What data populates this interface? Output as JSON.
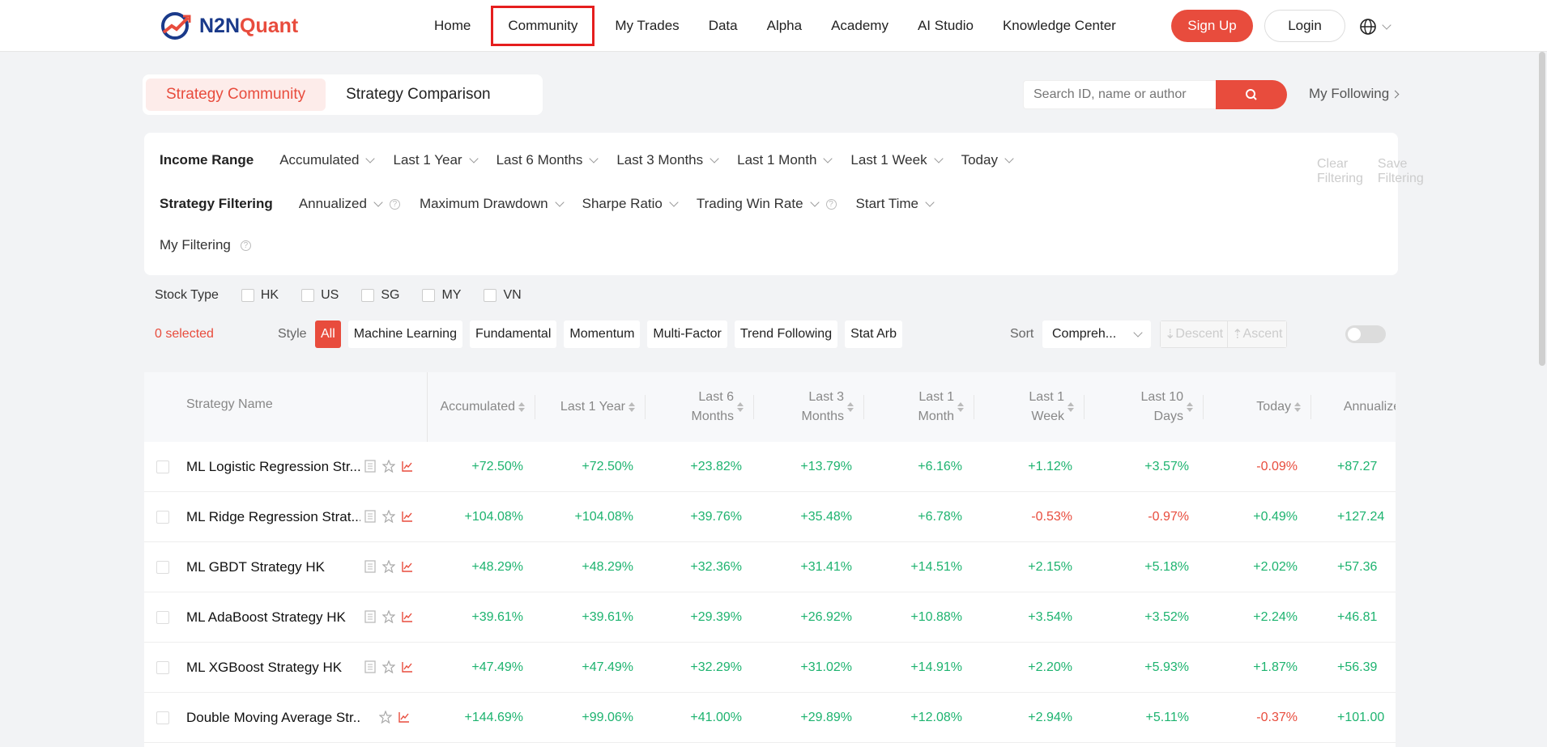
{
  "brand": {
    "part1": "N2N",
    "part2": "Quant"
  },
  "nav": [
    "Home",
    "Community",
    "My Trades",
    "Data",
    "Alpha",
    "Academy",
    "AI Studio",
    "Knowledge Center"
  ],
  "auth": {
    "signup": "Sign Up",
    "login": "Login"
  },
  "tabs": [
    "Strategy Community",
    "Strategy Comparison"
  ],
  "search": {
    "placeholder": "Search ID, name or author"
  },
  "my_following": "My Following",
  "filters": {
    "income_label": "Income Range",
    "income_options": [
      "Accumulated",
      "Last 1 Year",
      "Last 6 Months",
      "Last 3 Months",
      "Last 1 Month",
      "Last 1 Week",
      "Today"
    ],
    "strategy_label": "Strategy Filtering",
    "strategy_options": [
      "Annualized",
      "Maximum Drawdown",
      "Sharpe Ratio",
      "Trading Win Rate",
      "Start Time"
    ],
    "my_label": "My Filtering",
    "clear": "Clear Filtering",
    "save": "Save Filtering"
  },
  "stock": {
    "label": "Stock Type",
    "options": [
      "HK",
      "US",
      "SG",
      "MY",
      "VN"
    ]
  },
  "style": {
    "selected": "0 selected",
    "label": "Style",
    "tags": [
      "All",
      "Machine Learning",
      "Fundamental",
      "Momentum",
      "Multi-Factor",
      "Trend Following",
      "Stat Arb"
    ]
  },
  "sort": {
    "label": "Sort",
    "value": "Compreh...",
    "descent": "Descent",
    "ascent": "Ascent"
  },
  "table": {
    "name_header": "Strategy Name",
    "headers": [
      {
        "l1": "Accumulated",
        "l2": ""
      },
      {
        "l1": "Last 1 Year",
        "l2": ""
      },
      {
        "l1": "Last 6",
        "l2": "Months"
      },
      {
        "l1": "Last 3",
        "l2": "Months"
      },
      {
        "l1": "Last 1",
        "l2": "Month"
      },
      {
        "l1": "Last 1",
        "l2": "Week"
      },
      {
        "l1": "Last 10",
        "l2": "Days"
      },
      {
        "l1": "Today",
        "l2": ""
      },
      {
        "l1": "Annualized",
        "l2": ""
      }
    ],
    "rows": [
      {
        "name": "ML Logistic Regression Str...",
        "doc": true,
        "values": [
          "+72.50%",
          "+72.50%",
          "+23.82%",
          "+13.79%",
          "+6.16%",
          "+1.12%",
          "+3.57%",
          "-0.09%",
          "+87.27"
        ]
      },
      {
        "name": "ML Ridge Regression Strat...",
        "doc": true,
        "values": [
          "+104.08%",
          "+104.08%",
          "+39.76%",
          "+35.48%",
          "+6.78%",
          "-0.53%",
          "-0.97%",
          "+0.49%",
          "+127.24"
        ]
      },
      {
        "name": "ML GBDT Strategy HK",
        "doc": true,
        "values": [
          "+48.29%",
          "+48.29%",
          "+32.36%",
          "+31.41%",
          "+14.51%",
          "+2.15%",
          "+5.18%",
          "+2.02%",
          "+57.36"
        ]
      },
      {
        "name": "ML AdaBoost Strategy HK",
        "doc": true,
        "values": [
          "+39.61%",
          "+39.61%",
          "+29.39%",
          "+26.92%",
          "+10.88%",
          "+3.54%",
          "+3.52%",
          "+2.24%",
          "+46.81"
        ]
      },
      {
        "name": "ML XGBoost Strategy HK",
        "doc": true,
        "values": [
          "+47.49%",
          "+47.49%",
          "+32.29%",
          "+31.02%",
          "+14.91%",
          "+2.20%",
          "+5.93%",
          "+1.87%",
          "+56.39"
        ]
      },
      {
        "name": "Double Moving Average Str...",
        "doc": false,
        "values": [
          "+144.69%",
          "+99.06%",
          "+41.00%",
          "+29.89%",
          "+12.08%",
          "+2.94%",
          "+5.11%",
          "-0.37%",
          "+101.00"
        ]
      }
    ]
  },
  "colors": {
    "accent": "#e84c3d",
    "positive": "#1db36f",
    "brand": "#1a3a8a"
  }
}
